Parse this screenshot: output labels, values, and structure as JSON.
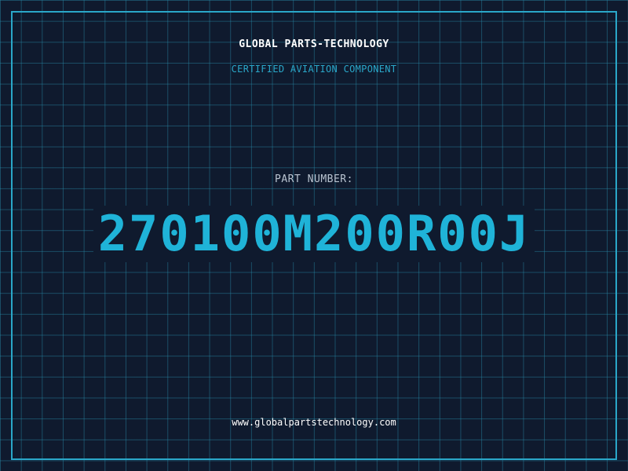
{
  "header": {
    "company": "GLOBAL PARTS-TECHNOLOGY",
    "subtitle": "CERTIFIED AVIATION COMPONENT"
  },
  "part": {
    "label": "PART NUMBER:",
    "number": "270100M200R00J"
  },
  "footer": {
    "url": "www.globalpartstechnology.com"
  },
  "colors": {
    "background": "#0f1a2e",
    "grid": "#288caa",
    "accent": "#2aa7c9",
    "part_number": "#1fb3d8"
  }
}
